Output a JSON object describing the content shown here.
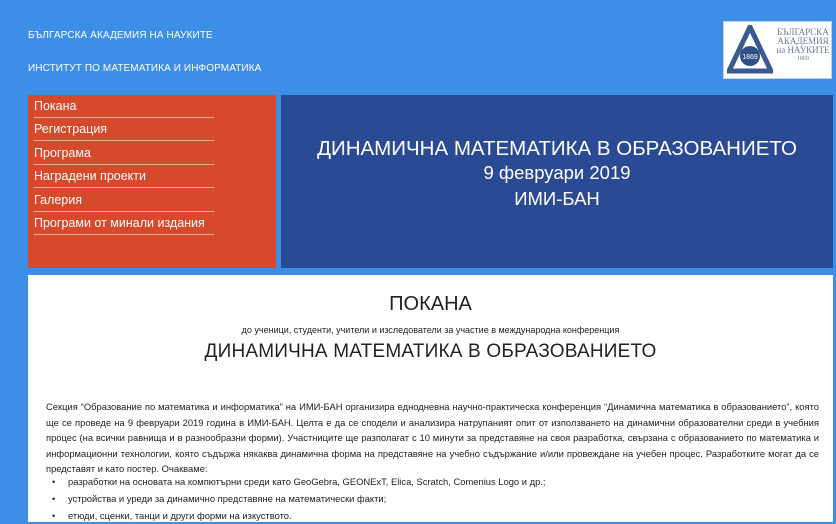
{
  "header": {
    "line1": "БЪЛГАРСКА АКАДЕМИЯ НА НАУКИТЕ",
    "line2": "ИНСТИТУТ ПО МАТЕМАТИКА И ИНФОРМАТИКА",
    "logo": {
      "emblem_year": "1869",
      "text_lines": [
        "БЪЛГАРСКА",
        "АКАДЕМИЯ",
        "на НАУКИТЕ",
        "1869"
      ]
    }
  },
  "menu": {
    "items": [
      {
        "label": "Покана"
      },
      {
        "label": "Регистрация"
      },
      {
        "label": "Програма"
      },
      {
        "label": "Наградени проекти"
      },
      {
        "label": "Галерия"
      },
      {
        "label": "Програми от минали издания"
      }
    ],
    "color": "#d6492a"
  },
  "banner": {
    "line1": "ДИНАМИЧНА МАТЕМАТИКА В ОБРАЗОВАНИЕТО",
    "line2": "9 февруари 2019",
    "line3": "ИМИ-БАН",
    "color": "#2b4a94"
  },
  "content": {
    "title": "ПОКАНА",
    "subtitle": "до ученици, студенти, учители и изследователи за участие в международна конференция",
    "conference": "ДИНАМИЧНА МАТЕМАТИКА В ОБРАЗОВАНИЕТО",
    "paragraph": "Секция “Образование по математика и информатика” на ИМИ-БАН организира еднодневна научно-практическа конференция “Динамична математика в образованието”, която ще се проведе на 9 февруари 2019 година в ИМИ-БАН. Целта е да се сподели и анализира натрупаният опит от използването на динамични образователни среди в учебния процес (на всички равнища и в разнообразни форми). Участниците ще разполагат с 10 минути за представяне на своя разработка, свързана с образованието по математика и информационни технологии, която съдържа някаква динамична форма на представяне на учебно съдържание и/или провеждане на учебен процес. Разработките могат да се представят и като постер. Очакваме:",
    "bullets": [
      "разработки на основата на компютърни среди като GeoGebra, GEONExT, Elica, Scratch, Comenius Logo и др.;",
      "устройства и уреди за динамично представяне на математически факти;",
      "етюди, сценки, танци и други форми на изкуството."
    ]
  },
  "colors": {
    "page_background": "#3d8ee6",
    "content_background": "#ffffff"
  }
}
